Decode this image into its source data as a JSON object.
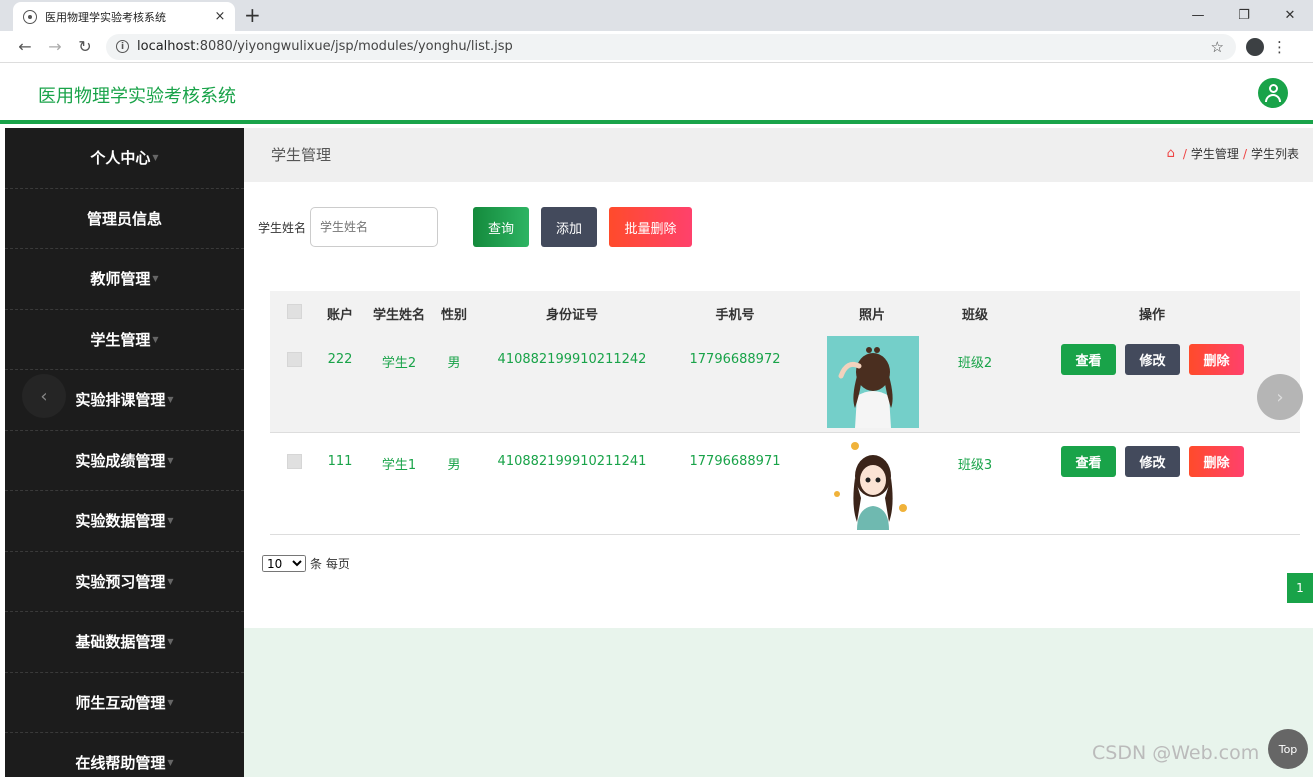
{
  "browser": {
    "tab_title": "医用物理学实验考核系统",
    "tab_close": "×",
    "new_tab": "+",
    "url_host": "localhost",
    "url_rest": ":8080/yiyongwulixue/jsp/modules/yonghu/list.jsp",
    "info": "i"
  },
  "app": {
    "title": "医用物理学实验考核系统"
  },
  "sidebar": {
    "items": [
      {
        "label": "个人中心",
        "caret": true
      },
      {
        "label": "管理员信息",
        "caret": false
      },
      {
        "label": "教师管理",
        "caret": true
      },
      {
        "label": "学生管理",
        "caret": true
      },
      {
        "label": "实验排课管理",
        "caret": true
      },
      {
        "label": "实验成绩管理",
        "caret": true
      },
      {
        "label": "实验数据管理",
        "caret": true
      },
      {
        "label": "实验预习管理",
        "caret": true
      },
      {
        "label": "基础数据管理",
        "caret": true
      },
      {
        "label": "师生互动管理",
        "caret": true
      },
      {
        "label": "在线帮助管理",
        "caret": true
      }
    ]
  },
  "breadcrumb": {
    "title": "学生管理",
    "crumbs": [
      "学生管理",
      "学生列表"
    ],
    "separator": "/"
  },
  "search": {
    "label": "学生姓名",
    "placeholder": "学生姓名",
    "query_label": "查询",
    "add_label": "添加",
    "batch_delete_label": "批量删除"
  },
  "table": {
    "headers": [
      "账户",
      "学生姓名",
      "性别",
      "身份证号",
      "手机号",
      "照片",
      "班级",
      "操作"
    ],
    "rows": [
      {
        "account": "222",
        "name": "学生2",
        "gender": "男",
        "id_number": "410882199910211242",
        "phone": "17796688972",
        "class": "班级2"
      },
      {
        "account": "111",
        "name": "学生1",
        "gender": "男",
        "id_number": "410882199910211241",
        "phone": "17796688971",
        "class": "班级3"
      }
    ],
    "actions": {
      "view": "查看",
      "edit": "修改",
      "delete": "删除"
    }
  },
  "pager": {
    "page_size": "10",
    "page_size_suffix": "条 每页",
    "current_page": "1"
  },
  "watermark": "CSDN @Web.com",
  "top_button": "Top",
  "colors": {
    "accent": "#19a349",
    "sidebar_bg": "#1c1c1c",
    "danger": "#ff416c",
    "dark_button": "#434a5c"
  }
}
